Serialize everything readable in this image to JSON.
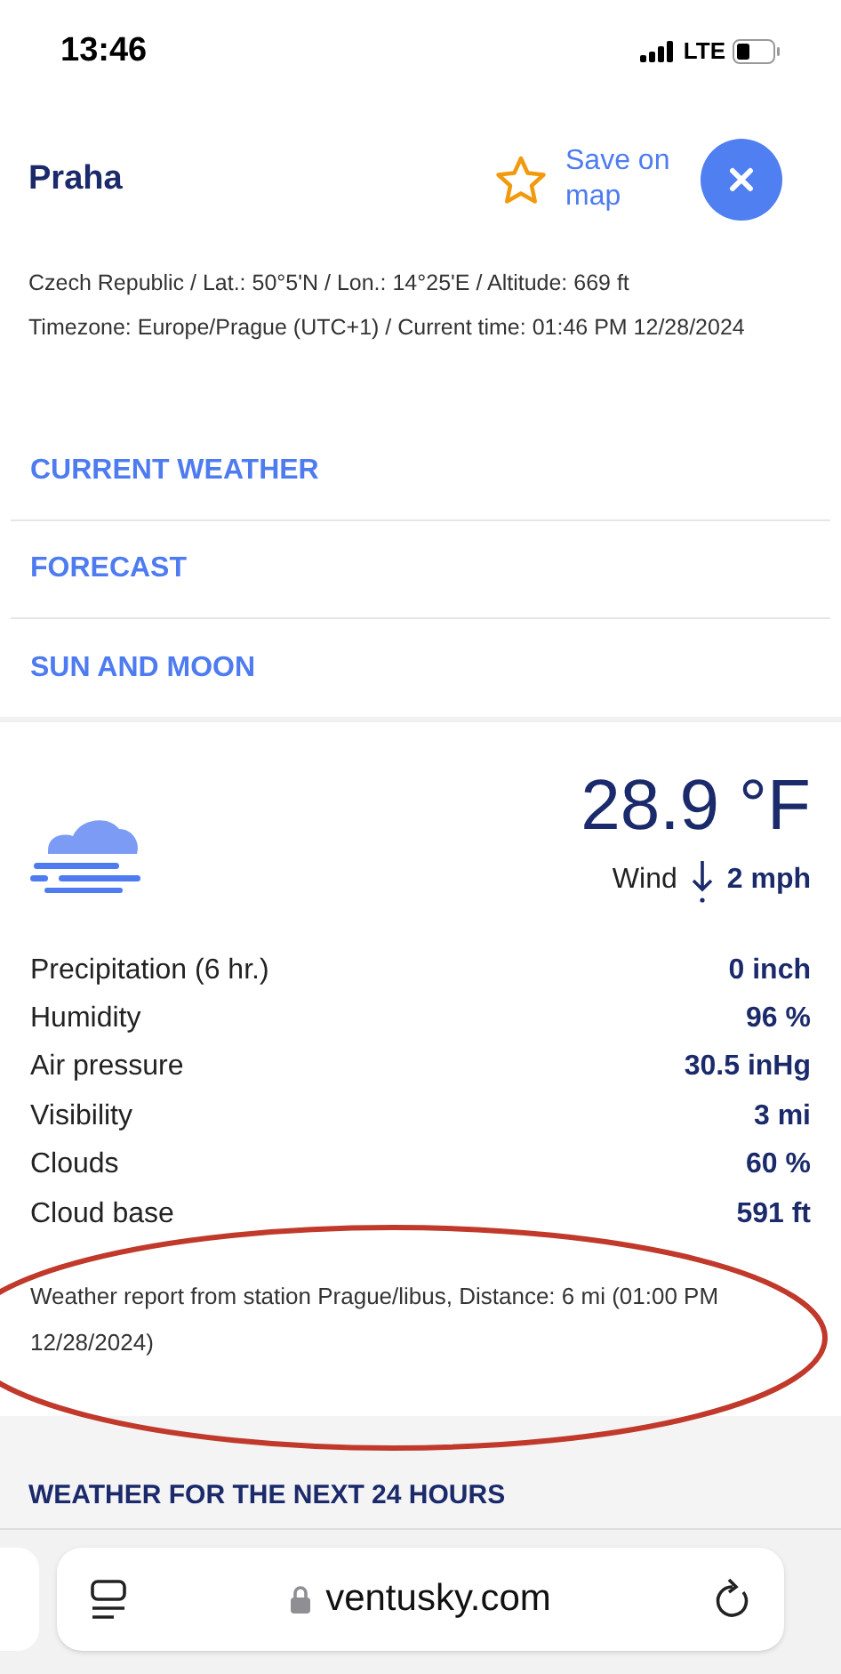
{
  "status_bar": {
    "time": "13:46",
    "network": "LTE"
  },
  "location": {
    "name": "Praha",
    "save_label": "Save on map",
    "saved": false,
    "details": [
      "Czech Republic / Lat.: 50°5'N / Lon.: 14°25'E / Altitude: 669 ft",
      "Timezone: Europe/Prague (UTC+1) / Current time: 01:46 PM 12/28/2024"
    ]
  },
  "menu": [
    {
      "label": "CURRENT WEATHER"
    },
    {
      "label": "FORECAST"
    },
    {
      "label": "SUN AND MOON"
    }
  ],
  "current": {
    "temperature": "28.9 °F",
    "wind_label": "Wind",
    "wind_speed": "2 mph",
    "rows": [
      {
        "label": "Precipitation (6 hr.)",
        "value": "0 inch"
      },
      {
        "label": "Humidity",
        "value": "96 %"
      },
      {
        "label": "Air pressure",
        "value": "30.5 inHg"
      },
      {
        "label": "Visibility",
        "value": "3 mi"
      },
      {
        "label": "Clouds",
        "value": "60 %"
      },
      {
        "label": "Cloud base",
        "value": "591 ft"
      }
    ],
    "report": "Weather report from station Prague/libus, Distance: 6 mi (01:00 PM 12/28/2024)"
  },
  "next_section": {
    "title": "WEATHER FOR THE NEXT 24 HOURS"
  },
  "browser": {
    "url": "ventusky.com"
  }
}
